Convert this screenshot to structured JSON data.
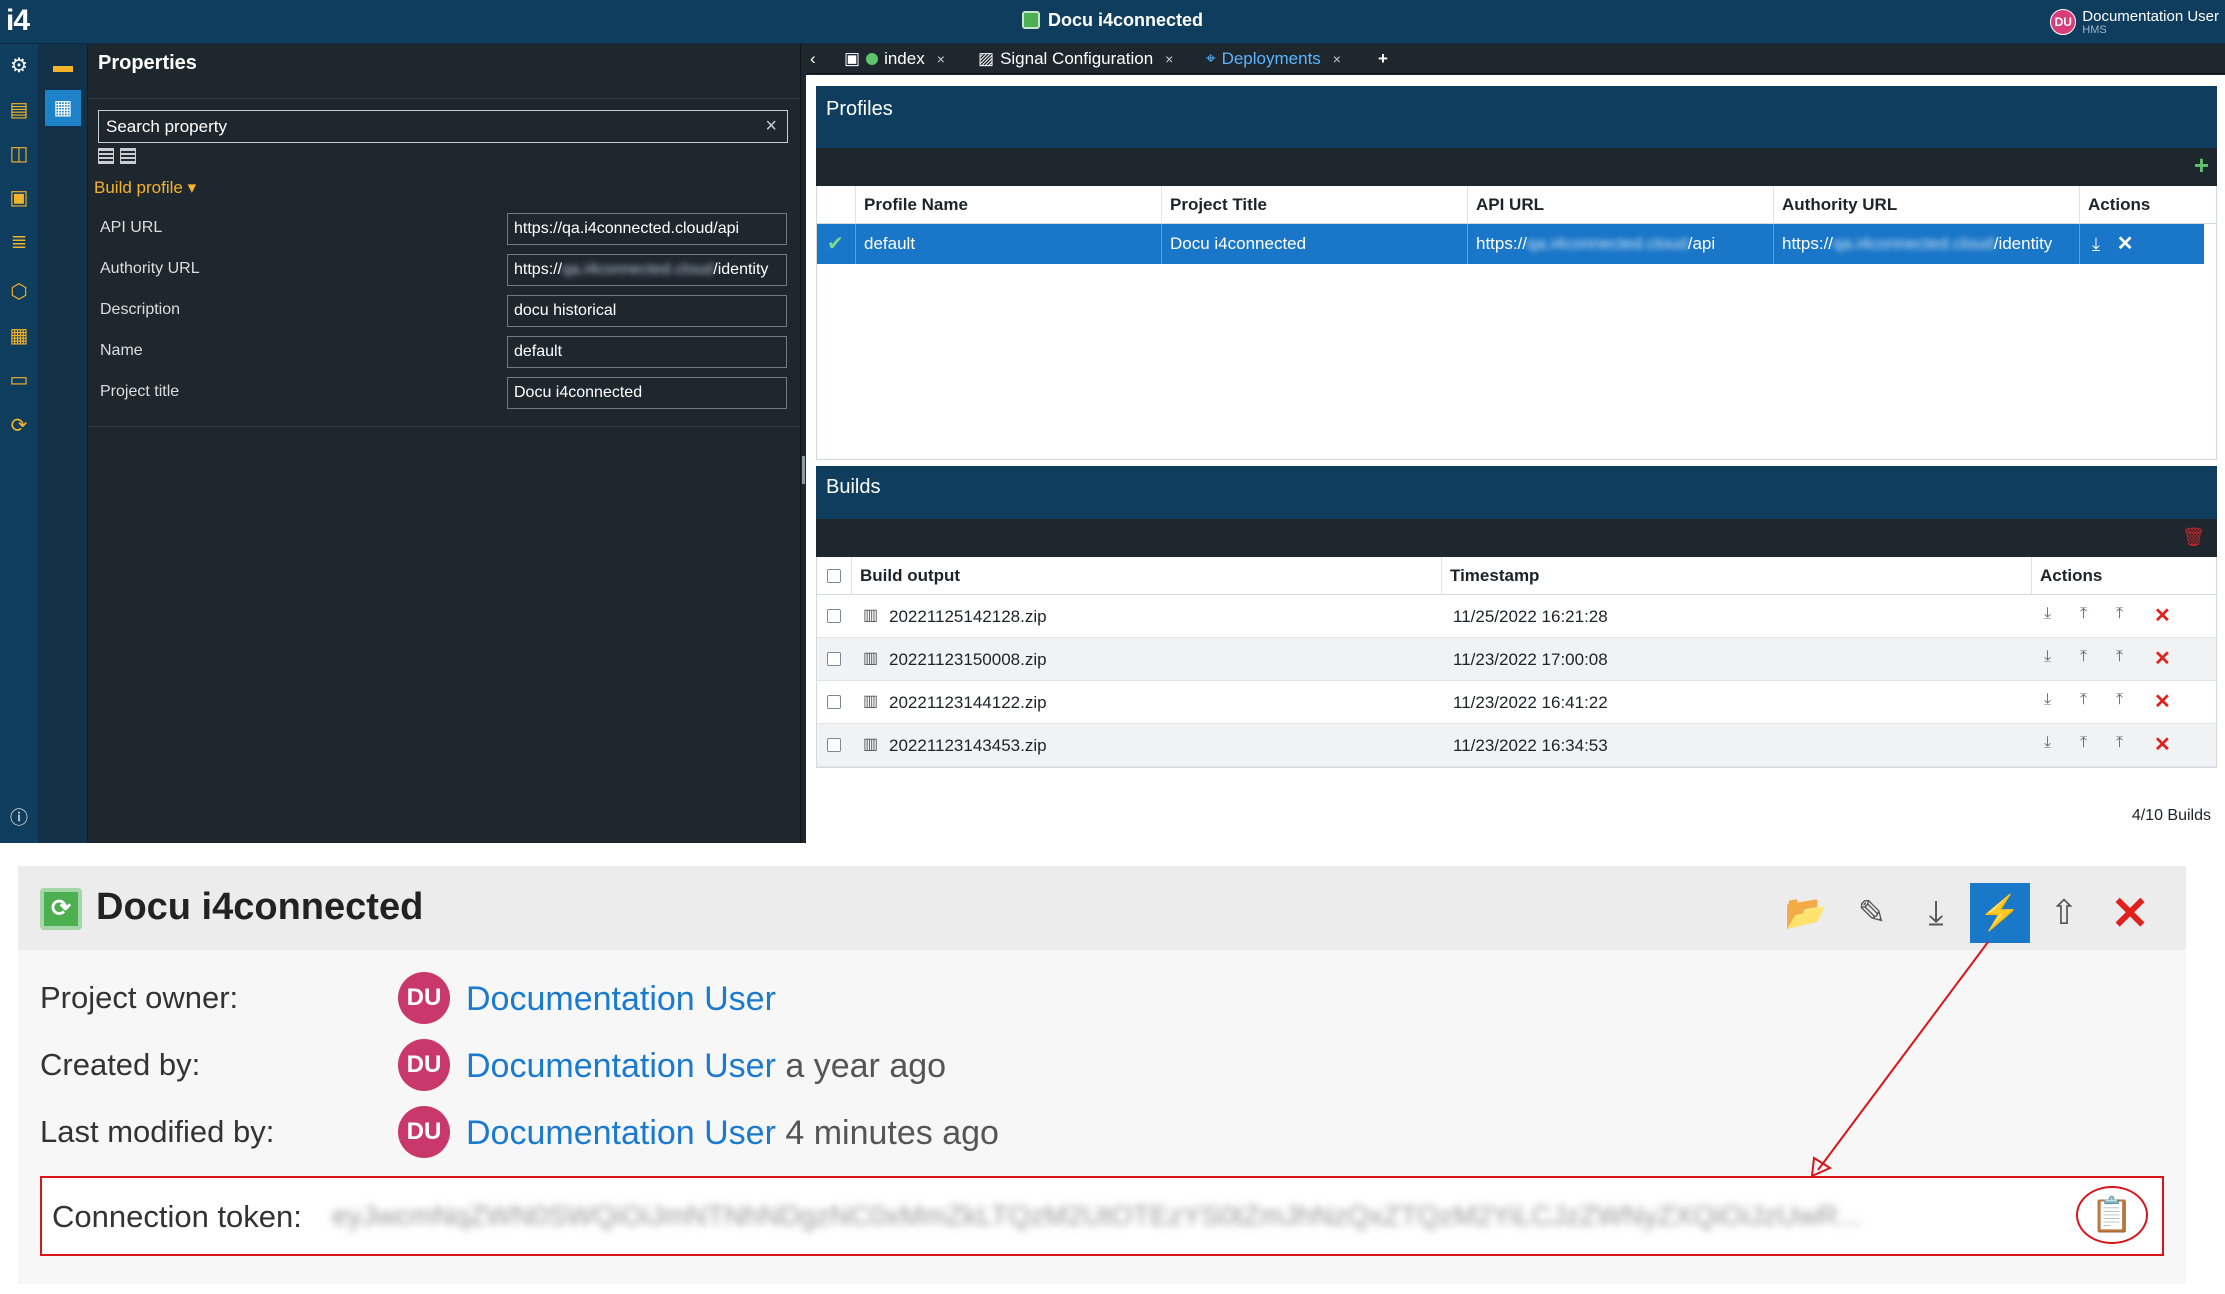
{
  "app": {
    "logo": "i4",
    "window_title": "Docu i4connected",
    "user": {
      "initials": "DU",
      "name": "Documentation User",
      "org": "HMS"
    }
  },
  "properties": {
    "title": "Properties",
    "search_placeholder": "Search property",
    "build_profile_label": "Build profile",
    "rows": [
      {
        "label": "API URL",
        "value": "https://qa.i4connected.cloud/api"
      },
      {
        "label": "Authority URL",
        "value_prefix": "https://",
        "value_blur": "qa.i4connected.cloud",
        "value_suffix": "/identity"
      },
      {
        "label": "Description",
        "value": "docu historical"
      },
      {
        "label": "Name",
        "value": "default"
      },
      {
        "label": "Project title",
        "value": "Docu i4connected"
      }
    ]
  },
  "tabs": [
    {
      "label": "index",
      "close": "×"
    },
    {
      "label": "Signal Configuration",
      "close": "×"
    },
    {
      "label": "Deployments",
      "close": "×"
    }
  ],
  "tabs_add": "+",
  "tabs_back": "‹",
  "profiles": {
    "title": "Profiles",
    "add": "+",
    "columns": [
      "Profile Name",
      "Project Title",
      "API URL",
      "Authority URL",
      "Actions"
    ],
    "row": {
      "name": "default",
      "project": "Docu i4connected",
      "api_prefix": "https://",
      "api_blur": "qa.i4connected.cloud",
      "api_suffix": "/api",
      "auth_prefix": "https://",
      "auth_blur": "qa.i4connected.cloud",
      "auth_suffix": "/identity"
    }
  },
  "builds": {
    "title": "Builds",
    "columns": [
      "Build output",
      "Timestamp",
      "Actions"
    ],
    "rows": [
      {
        "file": "20221125142128.zip",
        "timestamp": "11/25/2022 16:21:28"
      },
      {
        "file": "20221123150008.zip",
        "timestamp": "11/23/2022 17:00:08"
      },
      {
        "file": "20221123144122.zip",
        "timestamp": "11/23/2022 16:41:22"
      },
      {
        "file": "20221123143453.zip",
        "timestamp": "11/23/2022 16:34:53"
      }
    ],
    "footer": "4/10 Builds"
  },
  "project": {
    "title": "Docu i4connected",
    "owner_label": "Project owner:",
    "created_label": "Created by:",
    "modified_label": "Last modified by:",
    "user_initials": "DU",
    "user_name": "Documentation User",
    "created_ago": "a year ago",
    "modified_ago": "4 minutes ago",
    "token_label": "Connection token:",
    "token_value": "eyJwcmNqZWN0SWQiOiJmNTNhNDgzNC0xMmZkLTQzM2UtOTEzYS0tZmJhNzQxZTQzM2YiLCJzZWNyZXQiOiJzUwR..."
  },
  "colors": {
    "navy": "#0f3d5e",
    "selected_row": "#1976c8",
    "accent_yellow": "#f5b32b",
    "danger": "#e0201c",
    "link_blue": "#1a7ad0"
  }
}
